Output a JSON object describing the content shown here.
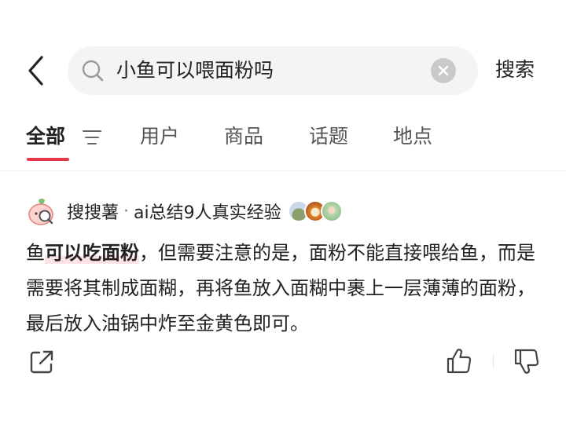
{
  "search": {
    "query": "小鱼可以喂面粉吗",
    "action_label": "搜索"
  },
  "tabs": [
    {
      "label": "全部",
      "active": true
    },
    {
      "label": "用户",
      "active": false
    },
    {
      "label": "商品",
      "active": false
    },
    {
      "label": "话题",
      "active": false
    },
    {
      "label": "地点",
      "active": false
    }
  ],
  "summary": {
    "source_name": "搜搜薯",
    "separator": "·",
    "source_summary": "ai总结9人真实经验",
    "answer_prefix": "鱼",
    "answer_highlight": "可以吃面粉",
    "answer_rest": "，但需要注意的是，面粉不能直接喂给鱼，而是需要将其制成面糊，再将鱼放入面糊中裹上一层薄薄的面粉，最后放入油锅中炸至金黄色即可。"
  },
  "colors": {
    "accent": "#e8364a",
    "search_bg": "#f4f4f5",
    "highlight_bg": "#fde3e6"
  },
  "icons": [
    "back-arrow-icon",
    "search-icon",
    "clear-icon",
    "filter-icon",
    "share-icon",
    "thumbs-up-icon",
    "thumbs-down-icon"
  ]
}
